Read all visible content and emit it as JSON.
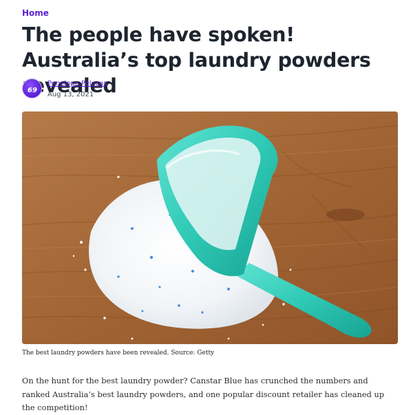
{
  "breadcrumb": {
    "label": "Home"
  },
  "article": {
    "title": "The people have spoken! Australia’s top laundry powders revealed",
    "author": {
      "name": "Penelope Pelecas",
      "avatar_glyph": "69"
    },
    "date": "Aug 13, 2021",
    "hero_image": {
      "caption": "The best laundry powders have been revealed. Source: Getty"
    },
    "intro": "On the hunt for the best laundry powder? Canstar Blue has crunched the numbers and ranked Australia’s best laundry powders, and one popular discount retailer has cleaned up the competition!"
  },
  "colors": {
    "accent": "#5a1fd1",
    "headline": "#1e2530",
    "wood": "#a76d3d",
    "scoop": "#2fc9b5"
  },
  "icons": {
    "avatar": "avatar-logo-icon"
  }
}
